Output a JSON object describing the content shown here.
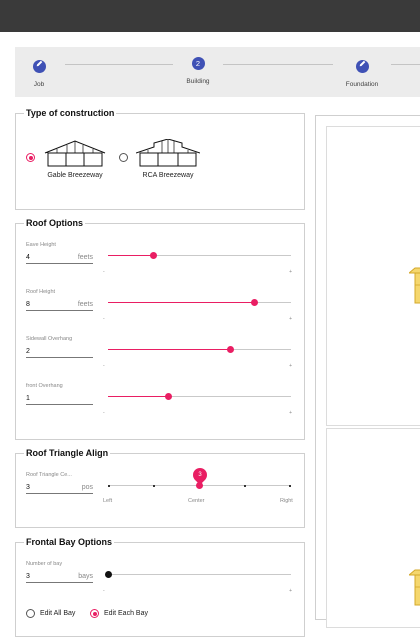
{
  "stepper": {
    "steps": [
      {
        "label": "Job",
        "state": "edit",
        "icon": "pencil-icon"
      },
      {
        "label": "Building",
        "state": "active",
        "number": "2"
      },
      {
        "label": "Foundation",
        "state": "edit",
        "icon": "pencil-icon"
      }
    ]
  },
  "construction": {
    "title": "Type of construction",
    "options": [
      {
        "label": "Gable Breezeway",
        "selected": true
      },
      {
        "label": "RCA Breezeway",
        "selected": false
      }
    ]
  },
  "roof": {
    "title": "Roof Options",
    "fields": [
      {
        "label": "Eave Height",
        "value": "4",
        "unit": "feets",
        "min": "-",
        "max": "+",
        "level": 0.25
      },
      {
        "label": "Roof Height",
        "value": "8",
        "unit": "feets",
        "min": "-",
        "max": "+",
        "level": 0.8
      },
      {
        "label": "Sidewall Overhang",
        "value": "2",
        "unit": "",
        "min": "-",
        "max": "+",
        "level": 0.67
      },
      {
        "label": "front Overhang",
        "value": "1",
        "unit": "",
        "min": "-",
        "max": "+",
        "level": 0.33
      }
    ]
  },
  "triangle": {
    "title": "Roof Triangle Align",
    "field_label": "Roof Triangle Ce...",
    "value": "3",
    "unit": "pos",
    "bubble": "3",
    "ticks": [
      "Left",
      "Center",
      "Right"
    ],
    "level": 0.5
  },
  "frontal": {
    "title": "Frontal Bay Options",
    "field_label": "Number of bay",
    "value": "3",
    "unit": "bays",
    "min": "-",
    "max": "+",
    "level": 0,
    "edit_options": [
      {
        "label": "Edit All Bay",
        "selected": false
      },
      {
        "label": "Edit Each Bay",
        "selected": true
      }
    ]
  },
  "colors": {
    "accent": "#e91e63",
    "primary": "#3f51b5",
    "building": "#f5d76e"
  }
}
